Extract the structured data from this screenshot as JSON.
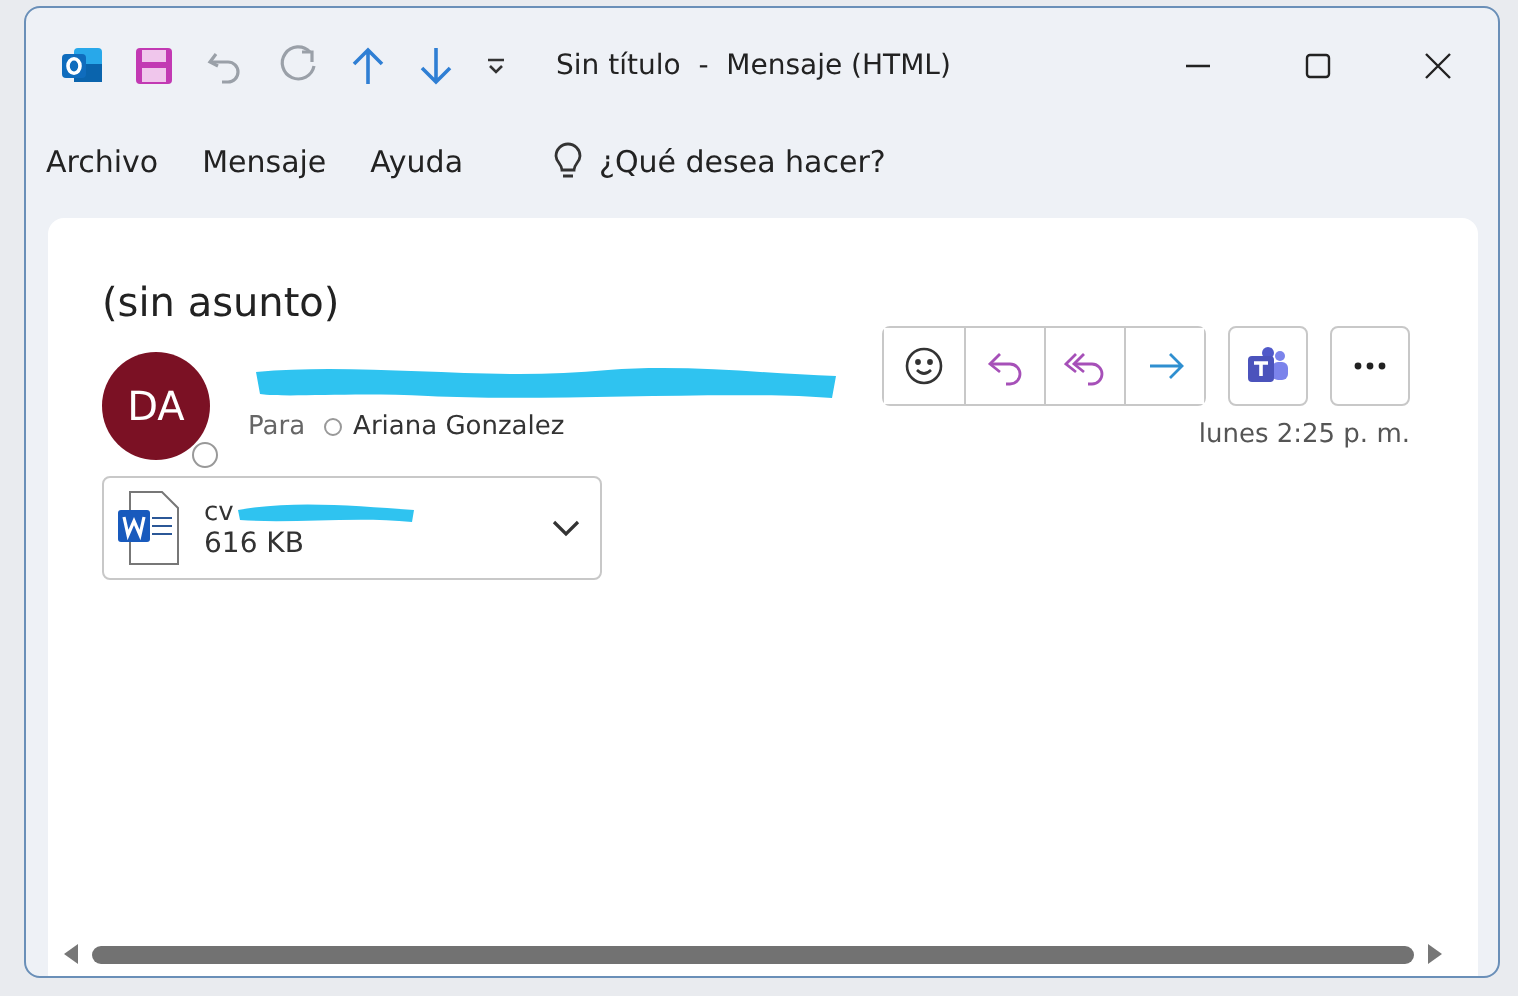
{
  "title_bar": {
    "title": "Sin título  -  Mensaje (HTML)"
  },
  "menu": [
    {
      "label": "Archivo"
    },
    {
      "label": "Mensaje"
    },
    {
      "label": "Ayuda"
    }
  ],
  "search": {
    "placeholder": "¿Qué desea hacer?"
  },
  "message": {
    "subject": "(sin asunto)",
    "sender": {
      "initials": "DA",
      "color": "#7b1124"
    },
    "to_label": "Para",
    "recipient": "Ariana Gonzalez",
    "time": "lunes 2:25 p. m.",
    "attachment": {
      "name": "cv",
      "size": "616 KB"
    }
  }
}
